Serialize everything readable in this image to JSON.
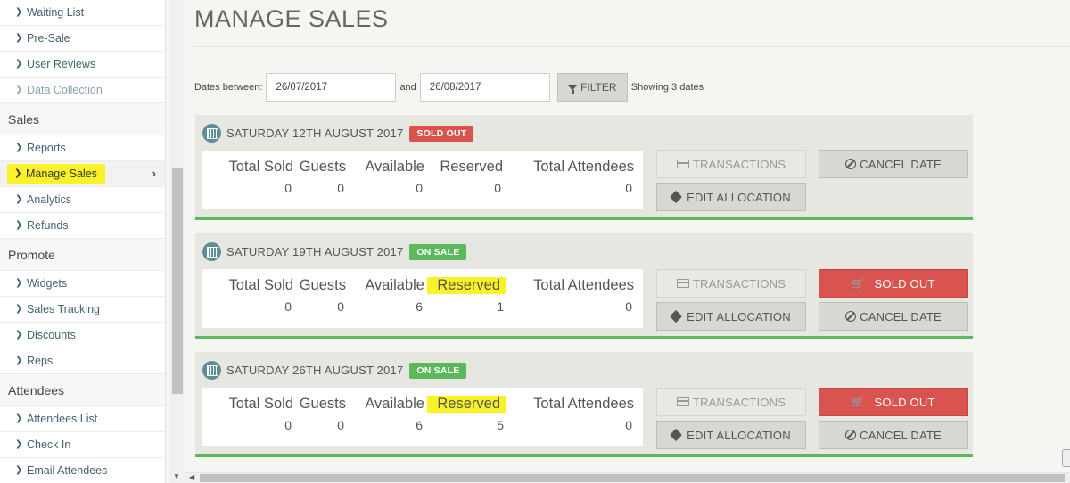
{
  "sidebar": {
    "items_top": [
      {
        "label": "Waiting List",
        "muted": false
      },
      {
        "label": "Pre-Sale",
        "muted": false
      },
      {
        "label": "User Reviews",
        "muted": false
      },
      {
        "label": "Data Collection",
        "muted": true
      }
    ],
    "groups": [
      {
        "title": "Sales",
        "items": [
          "Reports",
          "Manage Sales",
          "Analytics",
          "Refunds"
        ]
      },
      {
        "title": "Promote",
        "items": [
          "Widgets",
          "Sales Tracking",
          "Discounts",
          "Reps"
        ]
      },
      {
        "title": "Attendees",
        "items": [
          "Attendees List",
          "Check In",
          "Email Attendees"
        ]
      }
    ],
    "active_item": "Manage Sales"
  },
  "page": {
    "title": "MANAGE SALES"
  },
  "filter": {
    "label_between": "Dates between:",
    "start": "26/07/2017",
    "label_and": "and",
    "end": "26/08/2017",
    "button": "FILTER",
    "showing": "Showing 3 dates"
  },
  "stat_labels": [
    "Total Sold",
    "Guests",
    "Available",
    "Reserved",
    "Total Attendees"
  ],
  "buttons": {
    "transactions": "TRANSACTIONS",
    "edit_allocation": "EDIT ALLOCATION",
    "cancel_date": "CANCEL DATE",
    "sold_out": "SOLD OUT"
  },
  "dates": [
    {
      "date": "SATURDAY 12TH AUGUST 2017",
      "status": "SOLD OUT",
      "total_sold": "0",
      "guests": "0",
      "available": "0",
      "reserved": "0",
      "total_attendees": "0"
    },
    {
      "date": "SATURDAY 19TH AUGUST 2017",
      "status": "ON SALE",
      "total_sold": "0",
      "guests": "0",
      "available": "6",
      "reserved": "1",
      "total_attendees": "0"
    },
    {
      "date": "SATURDAY 26TH AUGUST 2017",
      "status": "ON SALE",
      "total_sold": "0",
      "guests": "0",
      "available": "6",
      "reserved": "5",
      "total_attendees": "0"
    }
  ],
  "colors": {
    "success": "#5cb85c",
    "danger": "#d9534f",
    "highlight": "#f8f226",
    "accent": "#5b8f98"
  }
}
